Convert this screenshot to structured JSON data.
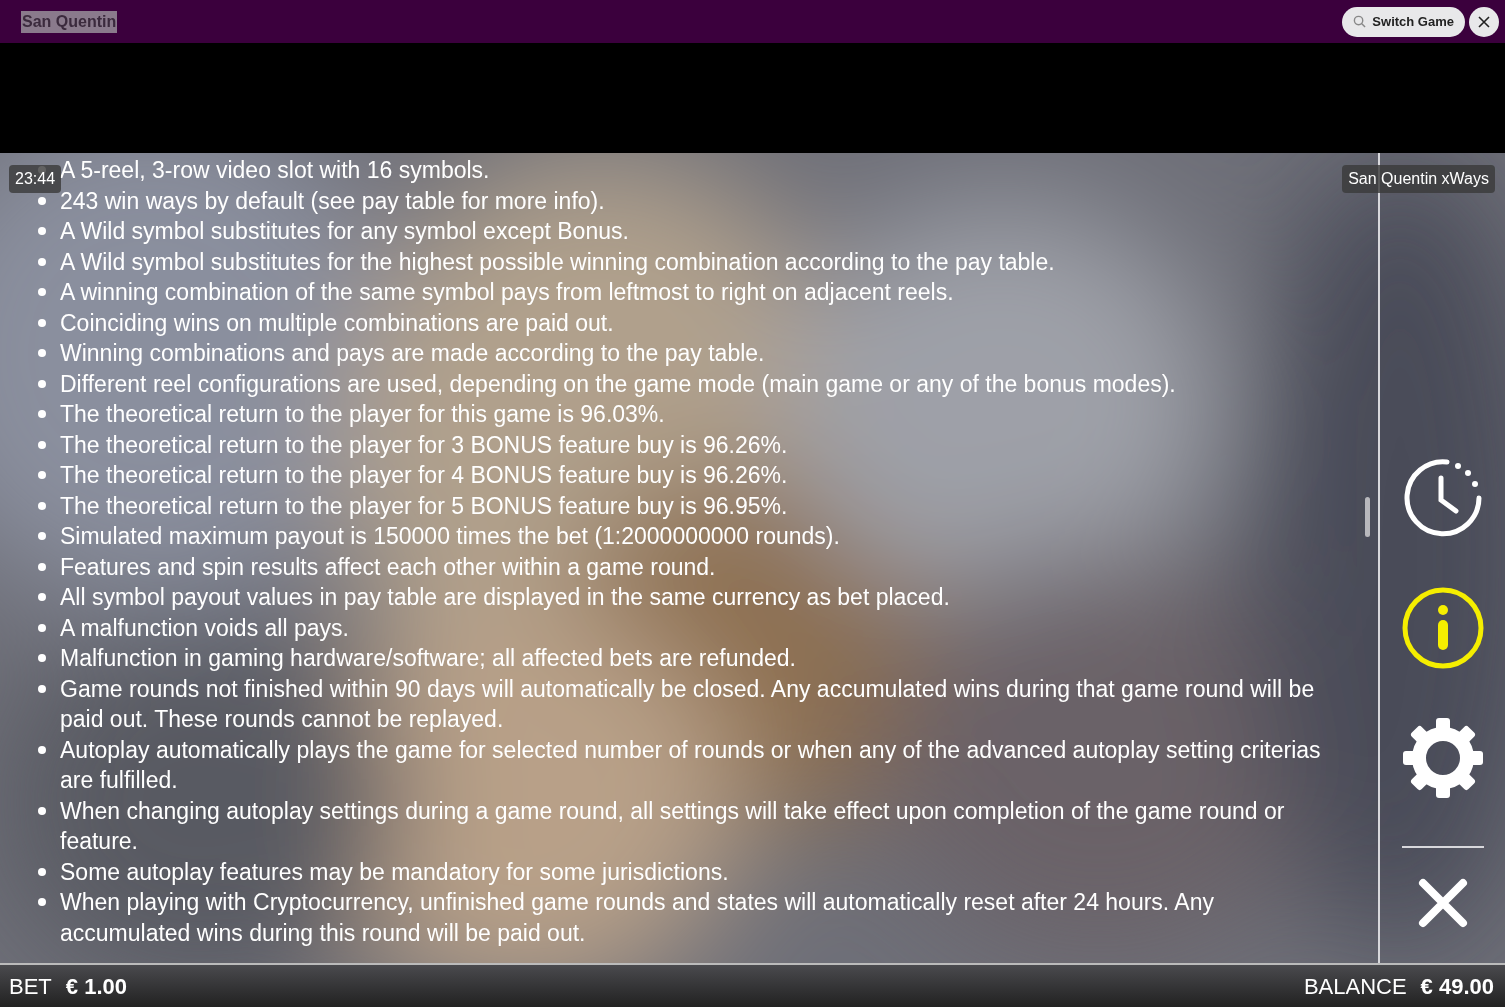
{
  "window": {
    "title": "San Quentin"
  },
  "header": {
    "switch_button": "Switch Game"
  },
  "timer": "23:44",
  "game_label": "San Quentin xWays",
  "rules": [
    "A 5-reel, 3-row video slot with 16 symbols.",
    "243 win ways by default (see pay table for more info).",
    "A Wild symbol substitutes for any symbol except Bonus.",
    "A Wild symbol substitutes for the highest possible winning combination according to the pay table.",
    "A winning combination of the same symbol pays from leftmost to right on adjacent reels.",
    "Coinciding wins on multiple combinations are paid out.",
    "Winning combinations and pays are made according to the pay table.",
    "Different reel configurations are used, depending on the game mode (main game or any of the bonus modes).",
    "The theoretical return to the player for this game is 96.03%.",
    "The theoretical return to the player for 3 BONUS feature buy is 96.26%.",
    "The theoretical return to the player for 4 BONUS feature buy is 96.26%.",
    "The theoretical return to the player for 5 BONUS feature buy is 96.95%.",
    "Simulated maximum payout is 150000 times the bet (1:2000000000 rounds).",
    "Features and spin results affect each other within a game round.",
    "All symbol payout values in pay table are displayed in the same currency as bet placed.",
    "A malfunction voids all pays.",
    "Malfunction in gaming hardware/software; all affected bets are refunded.",
    "Game rounds not finished within 90 days will automatically be closed. Any accumulated wins during that game round will be paid out. These rounds cannot be replayed.",
    "Autoplay automatically plays the game for selected number of rounds or when any of the advanced autoplay setting criterias are fulfilled.",
    "When changing autoplay settings during a game round, all settings will take effect upon completion of the game round or feature.",
    "Some autoplay features may be mandatory for some jurisdictions.",
    "When playing with Cryptocurrency, unfinished game rounds and states will automatically reset after 24 hours. Any accumulated wins during this round will be paid out."
  ],
  "side_buttons": [
    {
      "kind": "history",
      "selected": false
    },
    {
      "kind": "info",
      "selected": true
    },
    {
      "kind": "settings",
      "selected": false
    },
    {
      "kind": "close",
      "selected": false
    }
  ],
  "footer": {
    "bet_label": "BET",
    "bet_value": "€ 1.00",
    "balance_label": "BALANCE",
    "balance_value": "€ 49.00"
  }
}
